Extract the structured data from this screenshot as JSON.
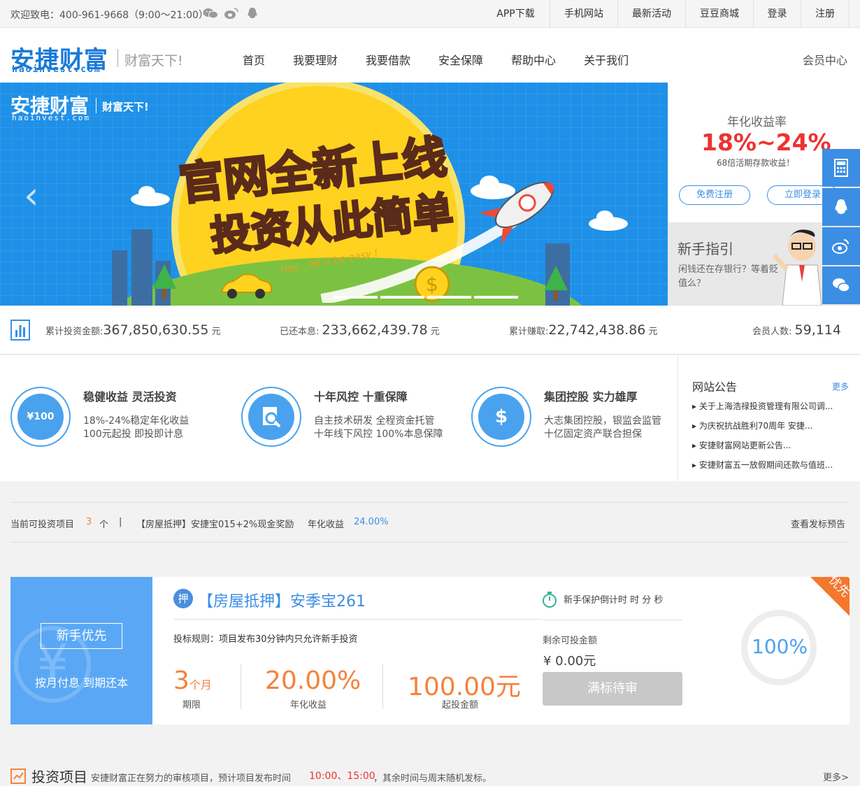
{
  "topbar": {
    "hotline": "欢迎致电：400-961-9668（9:00～21:00）",
    "links": [
      "APP下载",
      "手机网站",
      "最新活动",
      "豆豆商城",
      "登录",
      "注册"
    ]
  },
  "header": {
    "logo_cn": "安捷财富",
    "logo_en": "haoinvest.com",
    "slogan": "财富天下!",
    "nav": [
      "首页",
      "我要理财",
      "我要借款",
      "安全保障",
      "帮助中心",
      "关于我们"
    ],
    "member_center": "会员中心"
  },
  "banner": {
    "logo_cn": "安捷财富",
    "logo_en": "haoinvest.com",
    "slogan": "财富天下!",
    "title1_white": "官网",
    "title1_red": "全新上线",
    "title2_white": "投资从此",
    "title2_red": "简单",
    "script_text": "Hey , let it be easy !",
    "prev_arrow": "‹"
  },
  "login_panel": {
    "label": "年化收益率",
    "rate": "18%~24%",
    "sub": "68倍活期存款收益！",
    "register": "免费注册",
    "login": "立即登录"
  },
  "guide": {
    "title": "新手指引",
    "text": "闲钱还在存银行？等着贬值么？"
  },
  "side_float": [
    "calculator-icon",
    "qq-icon",
    "weibo-icon",
    "wechat-icon",
    "back-to-top-icon"
  ],
  "stats": {
    "total_invest_label": "累计投资金额:",
    "total_invest_value": "367,850,630.55",
    "repaid_label": "已还本息:",
    "repaid_value": "233,662,439.78",
    "earned_label": "累计赚取:",
    "earned_value": "22,742,438.86",
    "members_label": "会员人数:",
    "members_value": "59,114",
    "unit": "元"
  },
  "features": [
    {
      "icon": "envelope-money-icon",
      "icon_text": "¥100",
      "title": "稳健收益 灵活投资",
      "line1": "18%-24%稳定年化收益",
      "line2": "100元起投 即投即计息"
    },
    {
      "icon": "document-search-icon",
      "icon_text": "",
      "title": "十年风控 十重保障",
      "line1": "自主技术研发 全程资金托管",
      "line2": "十年线下风控 100%本息保障"
    },
    {
      "icon": "money-bag-icon",
      "icon_text": "$",
      "title": "集团控股 实力雄厚",
      "line1": "大志集团控股，银监会监管",
      "line2": "十亿固定资产联合担保"
    }
  ],
  "notice": {
    "title": "网站公告",
    "more": "更多",
    "items": [
      "关于上海浩禄投资管理有限公司调...",
      "为庆祝抗战胜利70周年 安捷...",
      "安捷财富网站更新公告...",
      "安捷财富五一放假期间还款与值班..."
    ]
  },
  "current": {
    "label": "当前可投资项目",
    "count": "3",
    "count_unit": "个",
    "divider": "|",
    "project": "【房屋抵押】安捷宝015+2%现金奖励",
    "rate_label": "年化收益",
    "rate": "24.00%",
    "preview": "查看发标预告"
  },
  "card": {
    "tag": "新手优先",
    "yen": "¥",
    "payment": "按月付息 到期还本",
    "badge": "押",
    "name": "【房屋抵押】安季宝261",
    "rule": "投标规则：项目发布30分钟内只允许新手投资",
    "term_num": "3",
    "term_unit": "个月",
    "term_label": "期限",
    "rate_value": "20.00%",
    "rate_label": "年化收益",
    "min_value": "100.00元",
    "min_label": "起投金额",
    "timer": "新手保护倒计时 时 分 秒",
    "remain_label": "剩余可投金额",
    "remain": "¥  0.00元",
    "button": "满标待审",
    "progress_pct": "100%",
    "progress": 1.0,
    "corner": "优先"
  },
  "invest_section": {
    "title": "投资项目",
    "desc": "安捷财富正在努力的审核项目，预计项目发布时间",
    "times": "10:00、15:00",
    "desc2": "，其余时间与周末随机发标。",
    "more": "更多>"
  }
}
